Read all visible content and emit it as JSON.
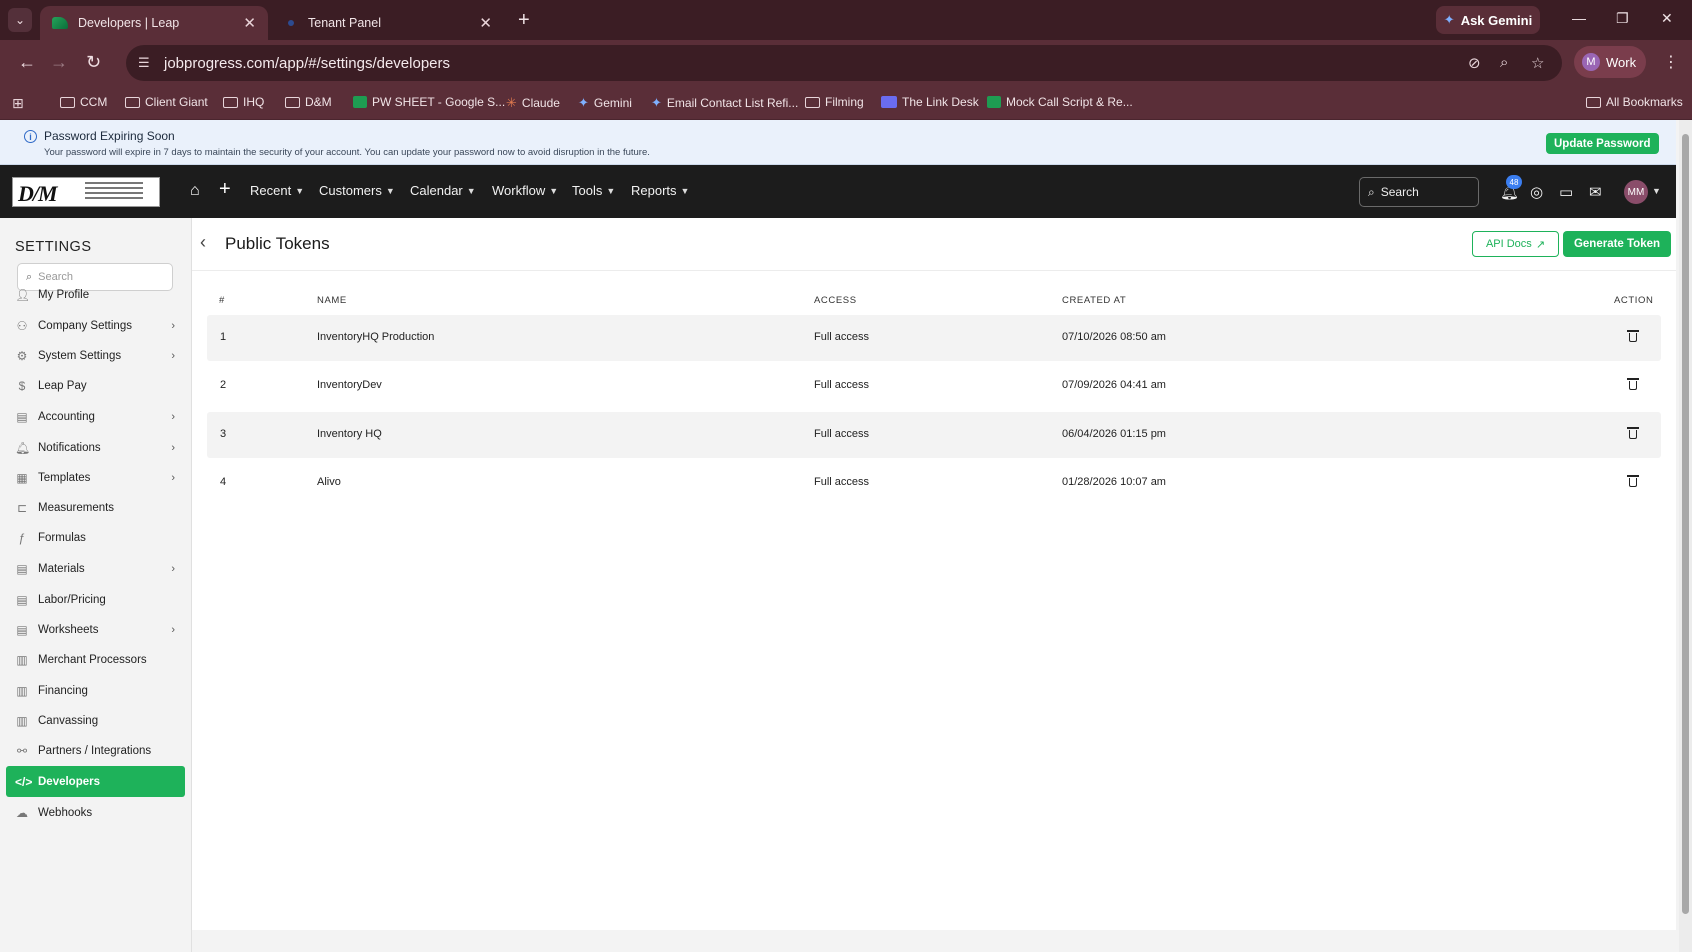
{
  "browser": {
    "tabs": [
      {
        "title": "Developers | Leap",
        "active": true
      },
      {
        "title": "Tenant Panel",
        "active": false
      }
    ],
    "ask_gemini": "Ask Gemini",
    "url": "jobprogress.com/app/#/settings/developers",
    "profile_initial": "M",
    "profile_label": "Work",
    "bookmarks": [
      {
        "label": "CCM",
        "icon": "folder-icon"
      },
      {
        "label": "Client Giant",
        "icon": "folder-icon"
      },
      {
        "label": "IHQ",
        "icon": "folder-icon"
      },
      {
        "label": "D&M",
        "icon": "folder-icon"
      },
      {
        "label": "PW SHEET - Google S...",
        "icon": "sheets-icon"
      },
      {
        "label": "Claude",
        "icon": "claude-icon"
      },
      {
        "label": "Gemini",
        "icon": "gemini-icon"
      },
      {
        "label": "Email Contact List Refi...",
        "icon": "gemini-icon"
      },
      {
        "label": "Filming",
        "icon": "folder-icon"
      },
      {
        "label": "The Link Desk",
        "icon": "page-icon"
      },
      {
        "label": "Mock Call Script & Re...",
        "icon": "sheets-icon"
      }
    ],
    "all_bookmarks": "All Bookmarks"
  },
  "banner": {
    "title": "Password Expiring Soon",
    "text": "Your password will expire in 7 days to maintain the security of your account. You can update your password now to avoid disruption in the future.",
    "button": "Update Password"
  },
  "nav": {
    "menus": [
      "Recent",
      "Customers",
      "Calendar",
      "Workflow",
      "Tools",
      "Reports"
    ],
    "search_placeholder": "Search",
    "notification_count": "48",
    "avatar_initials": "MM"
  },
  "sidebar": {
    "heading": "SETTINGS",
    "search_placeholder": "Search",
    "items": [
      {
        "label": "My Profile",
        "chevron": false,
        "icon": "user-icon"
      },
      {
        "label": "Company Settings",
        "chevron": true,
        "icon": "company-icon"
      },
      {
        "label": "System Settings",
        "chevron": true,
        "icon": "gear-icon"
      },
      {
        "label": "Leap Pay",
        "chevron": false,
        "icon": "dollar-icon"
      },
      {
        "label": "Accounting",
        "chevron": true,
        "icon": "accounting-icon"
      },
      {
        "label": "Notifications",
        "chevron": true,
        "icon": "bell-icon"
      },
      {
        "label": "Templates",
        "chevron": true,
        "icon": "template-icon"
      },
      {
        "label": "Measurements",
        "chevron": false,
        "icon": "measure-icon"
      },
      {
        "label": "Formulas",
        "chevron": false,
        "icon": "formula-icon"
      },
      {
        "label": "Materials",
        "chevron": true,
        "icon": "materials-icon"
      },
      {
        "label": "Labor/Pricing",
        "chevron": false,
        "icon": "labor-icon"
      },
      {
        "label": "Worksheets",
        "chevron": true,
        "icon": "worksheet-icon"
      },
      {
        "label": "Merchant Processors",
        "chevron": false,
        "icon": "merchant-icon"
      },
      {
        "label": "Financing",
        "chevron": false,
        "icon": "financing-icon"
      },
      {
        "label": "Canvassing",
        "chevron": false,
        "icon": "canvassing-icon"
      },
      {
        "label": "Partners / Integrations",
        "chevron": false,
        "icon": "partners-icon"
      },
      {
        "label": "Developers",
        "chevron": false,
        "icon": "code-icon",
        "active": true
      },
      {
        "label": "Webhooks",
        "chevron": false,
        "icon": "webhook-icon"
      }
    ]
  },
  "page": {
    "title": "Public Tokens",
    "api_docs": "API Docs",
    "generate": "Generate Token",
    "columns": {
      "num": "#",
      "name": "NAME",
      "access": "ACCESS",
      "created": "CREATED AT",
      "action": "ACTION"
    },
    "rows": [
      {
        "num": "1",
        "name": "InventoryHQ Production",
        "access": "Full access",
        "created": "07/10/2026 08:50 am"
      },
      {
        "num": "2",
        "name": "InventoryDev",
        "access": "Full access",
        "created": "07/09/2026 04:41 am"
      },
      {
        "num": "3",
        "name": "Inventory HQ",
        "access": "Full access",
        "created": "06/04/2026 01:15 pm"
      },
      {
        "num": "4",
        "name": "Alivo",
        "access": "Full access",
        "created": "01/28/2026 10:07 am"
      }
    ]
  },
  "colors": {
    "accent": "#1eb25a",
    "chrome_dark": "#3b1d24",
    "chrome": "#5a2e38",
    "appbar": "#1c1c1c"
  }
}
